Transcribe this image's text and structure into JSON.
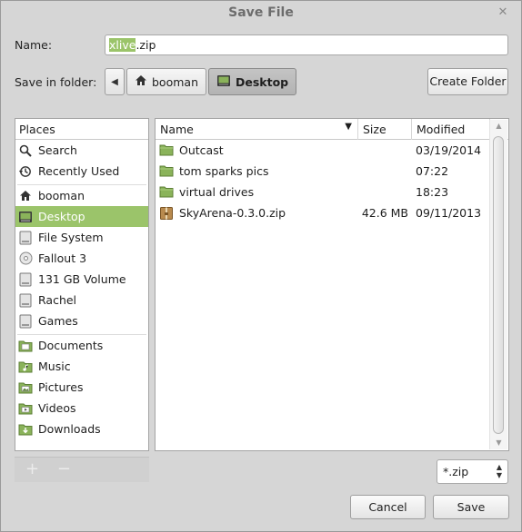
{
  "window": {
    "title": "Save File",
    "close_glyph": "✕"
  },
  "name_field": {
    "label": "Name:",
    "value_selected": "xlive",
    "value_rest": ".zip"
  },
  "folder": {
    "label": "Save in folder:",
    "back_glyph": "◀",
    "crumbs": [
      {
        "label": "booman",
        "icon": "home-icon",
        "active": false
      },
      {
        "label": "Desktop",
        "icon": "desktop-icon",
        "active": true
      }
    ],
    "create_folder_label": "Create Folder"
  },
  "places": {
    "header": "Places",
    "groups": [
      [
        {
          "label": "Search",
          "icon": "search-icon"
        },
        {
          "label": "Recently Used",
          "icon": "recent-icon"
        }
      ],
      [
        {
          "label": "booman",
          "icon": "home-icon"
        },
        {
          "label": "Desktop",
          "icon": "desktop-icon",
          "selected": true
        },
        {
          "label": "File System",
          "icon": "drive-icon"
        },
        {
          "label": "Fallout 3",
          "icon": "disc-icon"
        },
        {
          "label": "131 GB Volume",
          "icon": "drive-icon"
        },
        {
          "label": "Rachel",
          "icon": "drive-icon"
        },
        {
          "label": "Games",
          "icon": "drive-icon"
        }
      ],
      [
        {
          "label": "Documents",
          "icon": "folder-documents-icon"
        },
        {
          "label": "Music",
          "icon": "folder-music-icon"
        },
        {
          "label": "Pictures",
          "icon": "folder-pictures-icon"
        },
        {
          "label": "Videos",
          "icon": "folder-videos-icon"
        },
        {
          "label": "Downloads",
          "icon": "folder-downloads-icon"
        }
      ]
    ],
    "add_glyph": "+",
    "remove_glyph": "−"
  },
  "files": {
    "columns": {
      "name": "Name",
      "size": "Size",
      "modified": "Modified"
    },
    "sort_glyph": "▼",
    "rows": [
      {
        "name": "Outcast",
        "size": "",
        "modified": "03/19/2014",
        "icon": "folder-icon"
      },
      {
        "name": "tom sparks pics",
        "size": "",
        "modified": "07:22",
        "icon": "folder-icon"
      },
      {
        "name": "virtual drives",
        "size": "",
        "modified": "18:23",
        "icon": "folder-icon"
      },
      {
        "name": "SkyArena-0.3.0.zip",
        "size": "42.6 MB",
        "modified": "09/11/2013",
        "icon": "archive-icon"
      }
    ]
  },
  "filter": {
    "value": "*.zip"
  },
  "buttons": {
    "cancel": "Cancel",
    "save": "Save"
  },
  "colors": {
    "accent": "#9bc46a",
    "folder": "#8ab35a"
  }
}
